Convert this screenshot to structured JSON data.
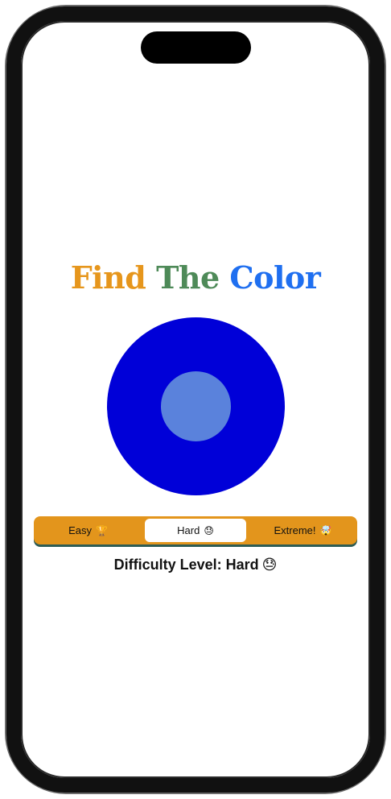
{
  "title": {
    "word1": "Find",
    "word2": "The",
    "word3": "Color"
  },
  "target": {
    "outer_color": "#0000d8",
    "inner_color": "#5a82dc"
  },
  "difficulty_picker": {
    "selected": "Hard",
    "options": [
      {
        "label": "Easy",
        "emoji": "🏆"
      },
      {
        "label": "Hard",
        "emoji": "😓"
      },
      {
        "label": "Extreme!",
        "emoji": "🤯"
      }
    ]
  },
  "difficulty_status": {
    "prefix": "Difficulty Level:",
    "value": "Hard",
    "emoji": "😓"
  },
  "colors": {
    "find": "#e6961c",
    "the": "#4e8a58",
    "color": "#1f6ff0",
    "picker_bg": "#e3951c"
  }
}
